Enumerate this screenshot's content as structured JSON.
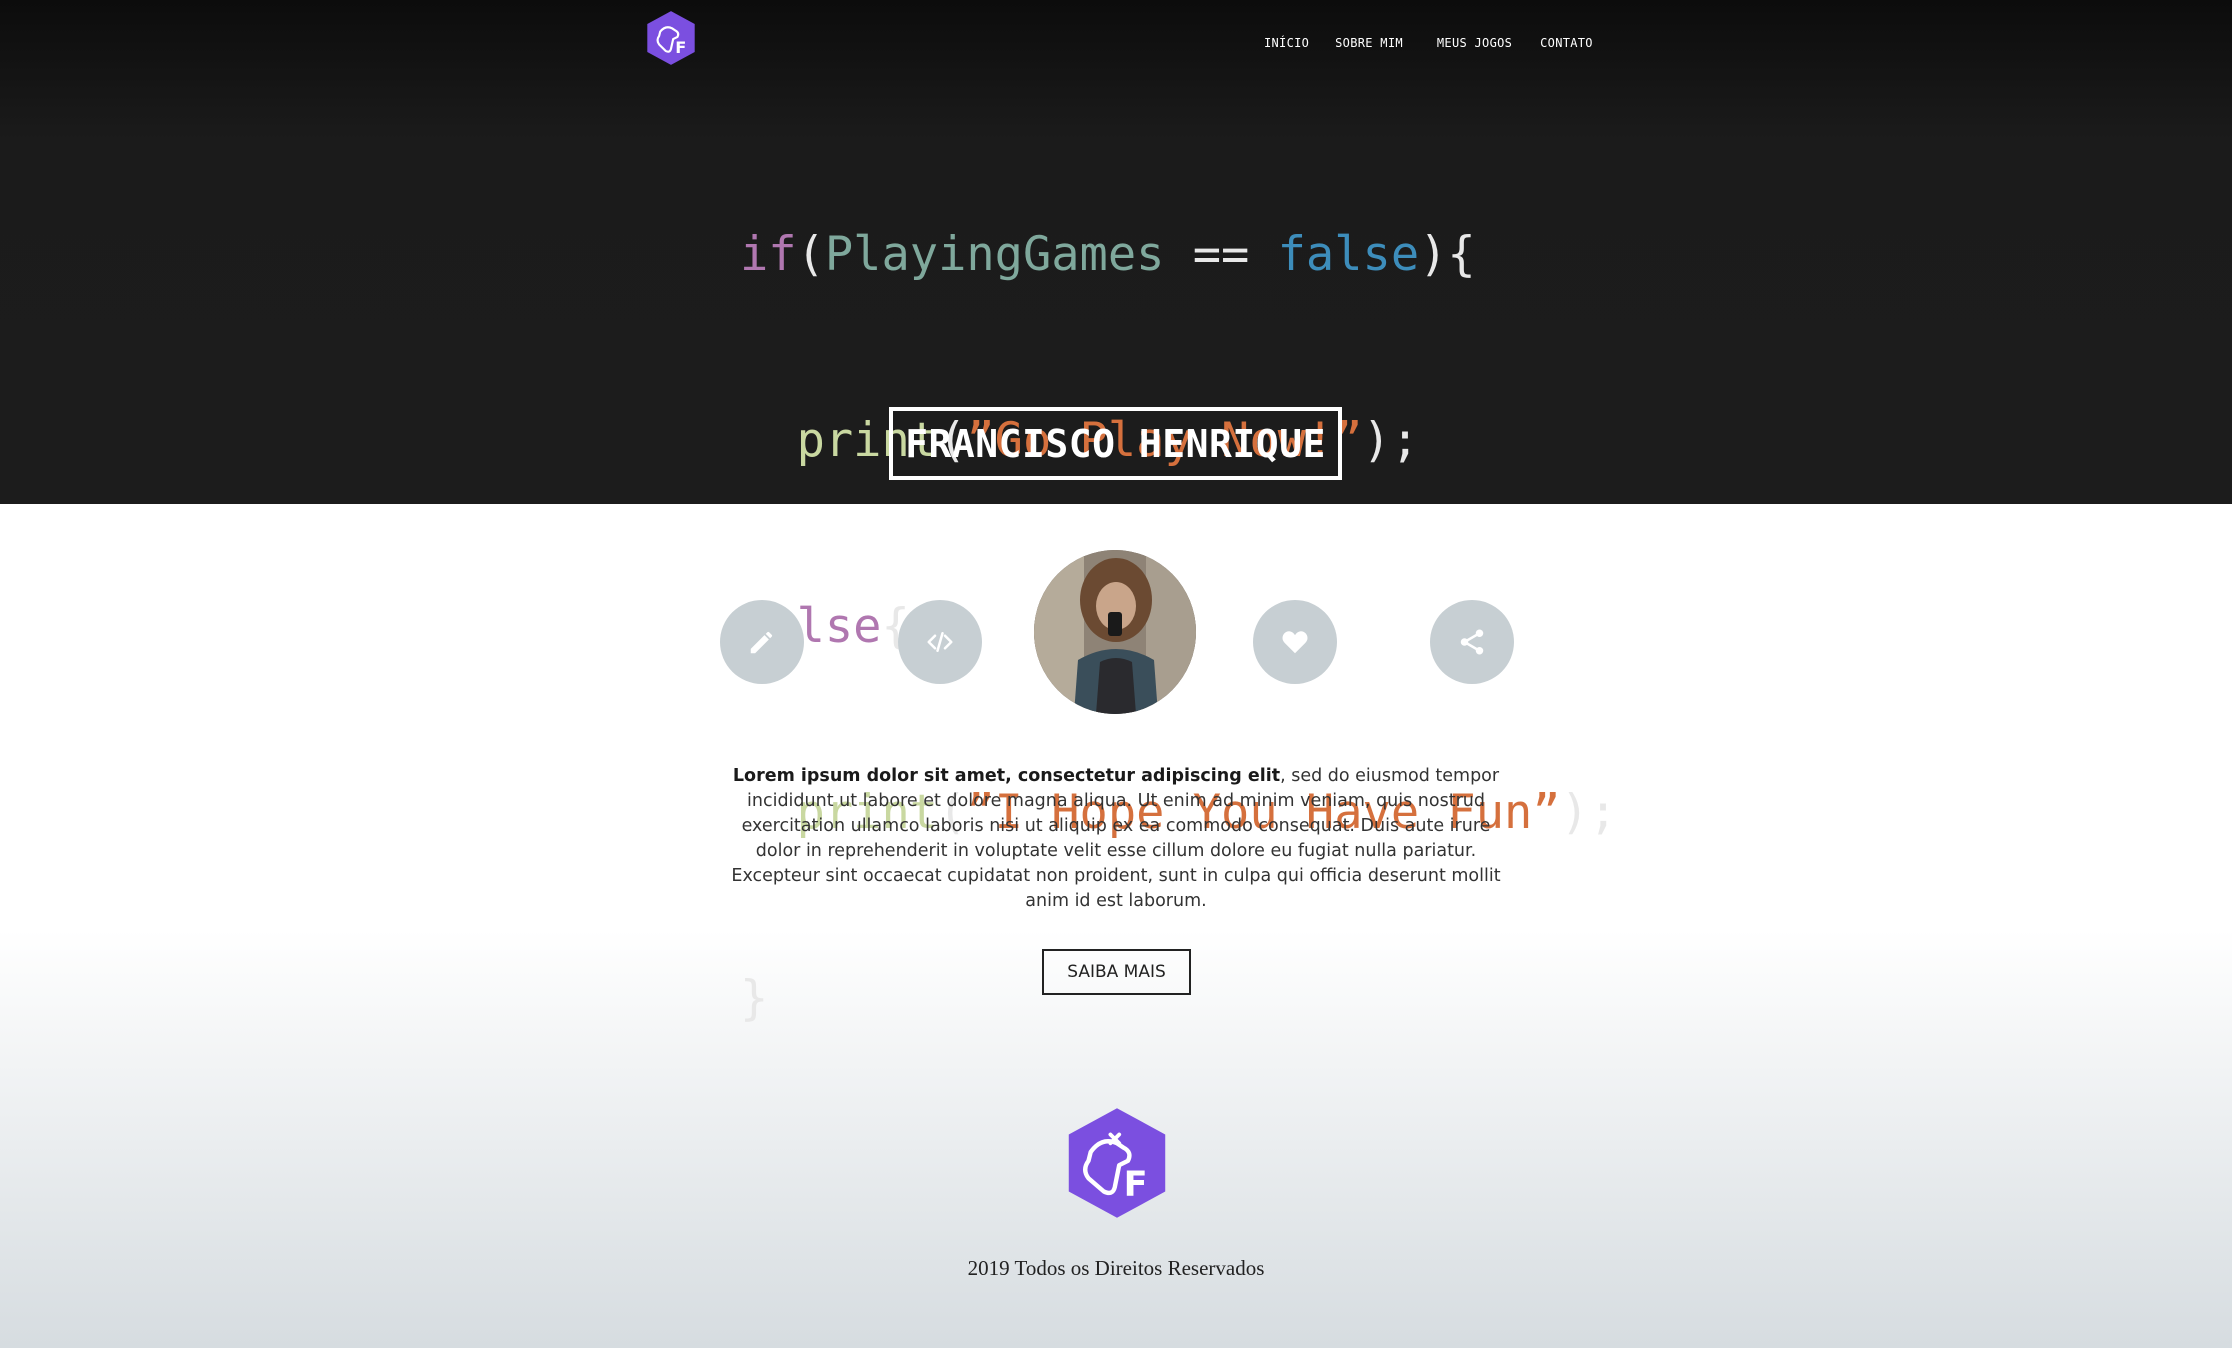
{
  "nav": {
    "items": [
      {
        "label": "INÍCIO"
      },
      {
        "label": "SOBRE MIM"
      },
      {
        "label": "MEUS JOGOS"
      },
      {
        "label": "CONTATO"
      }
    ]
  },
  "hero": {
    "code": {
      "line1": {
        "kw": "if",
        "open": "(",
        "var": "PlayingGames",
        "op": " == ",
        "bool": "false",
        "close": "){"
      },
      "line2": {
        "indent": "  ",
        "fn": "print",
        "open": "(",
        "str": "”Go Play Now!”",
        "close": ");"
      },
      "line3": {
        "brace": "}",
        "kw": "else",
        "open": "{"
      },
      "line4": {
        "indent": "  ",
        "fn": "print",
        "open": "(",
        "str": "”I Hope You Have Fun”",
        "close": ");"
      },
      "line5": {
        "brace": "}"
      }
    },
    "name": "FRANCISCO HENRIQUE"
  },
  "icons": [
    "pencil-icon",
    "code-icon",
    "heart-icon",
    "share-icon"
  ],
  "colors": {
    "brand": "#7b4fe0",
    "icon_circle": "#c7cfd3"
  },
  "about": {
    "bold": "Lorem ipsum dolor sit amet, consectetur adipiscing elit",
    "rest": ", sed do eiusmod tempor incididunt ut labore et dolore magna aliqua. Ut enim ad minim veniam, quis nostrud exercitation ullamco laboris nisi ut aliquip ex ea commodo consequat. Duis aute irure dolor in reprehenderit in voluptate velit esse cillum dolore eu fugiat nulla pariatur. Excepteur sint occaecat cupidatat non proident, sunt in culpa qui officia deserunt mollit anim id est laborum.",
    "button_label": "SAIBA MAIS"
  },
  "footer": {
    "text": "2019 Todos os Direitos Reservados"
  }
}
